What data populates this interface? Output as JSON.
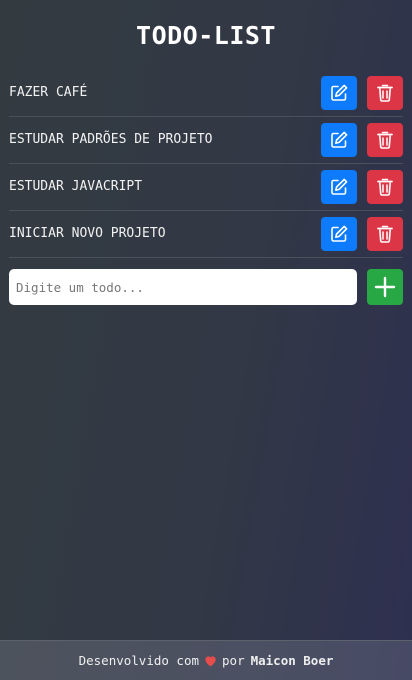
{
  "header": {
    "title": "TODO-LIST"
  },
  "todos": [
    {
      "text": "FAZER CAFÉ"
    },
    {
      "text": "ESTUDAR PADRÕES DE PROJETO"
    },
    {
      "text": "ESTUDAR JAVACRIPT"
    },
    {
      "text": "INICIAR NOVO PROJETO"
    }
  ],
  "icons": {
    "edit": "edit-icon",
    "delete": "trash-icon",
    "add": "plus-icon",
    "heart": "heart-icon"
  },
  "new_todo": {
    "placeholder": "Digite um todo...",
    "value": ""
  },
  "footer": {
    "prefix": "Desenvolvido com",
    "middle": "por",
    "author": "Maicon Boer"
  },
  "colors": {
    "edit_button": "#0d7bfb",
    "delete_button": "#dc3545",
    "add_button": "#28a745",
    "heart": "#e74c4c"
  }
}
